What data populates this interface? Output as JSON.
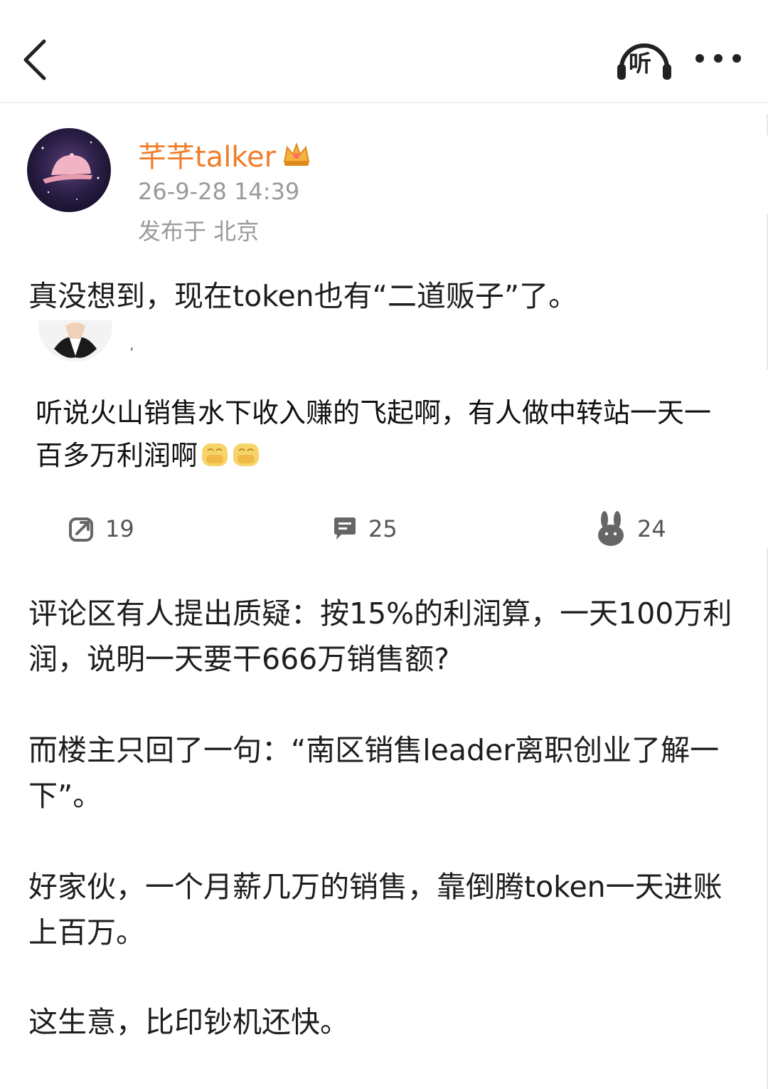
{
  "header": {
    "listen_label": "听",
    "back_icon": "chevron-left-icon",
    "listen_icon": "headphones-icon",
    "more_icon": "more-dots-icon"
  },
  "post": {
    "author": "芊芊talker",
    "timestamp": "26-9-28 14:39",
    "location": "发布于 北京",
    "intro": "真没想到，现在token也有“二道贩子”了。"
  },
  "embedded": {
    "text": "听说火山销售水下收入赚的飞起啊，有人做中转站一天一百多万利润啊",
    "emoji": "clasp-hands-emoji"
  },
  "actions": {
    "repost_count": "19",
    "comment_count": "25",
    "like_count": "24"
  },
  "body": [
    "评论区有人提出质疑：按15%的利润算，一天100万利润，说明一天要干666万销售额?",
    "而楼主只回了一句：“南区销售leader离职创业了解一下”。",
    "好家伙，一个月薪几万的销售，靠倒腾token一天进账上百万。",
    "这生意，比印钞机还快。"
  ],
  "colors": {
    "username": "#f07d2a",
    "meta": "#9a9a9a",
    "text": "#1e1e1e"
  }
}
